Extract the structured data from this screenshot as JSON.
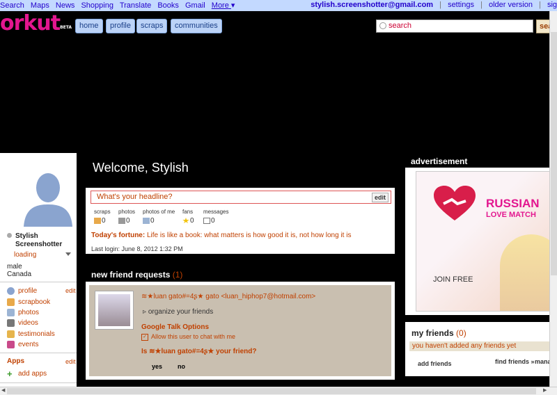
{
  "topbar": {
    "links": [
      "Search",
      "Maps",
      "News",
      "Shopping",
      "Translate",
      "Books",
      "Gmail"
    ],
    "more_label": "More",
    "more_caret": "▾",
    "email": "stylish.screenshotter@gmail.com",
    "settings": "settings",
    "older_version": "older version",
    "signout": "sig"
  },
  "logo": {
    "text": "orkut",
    "badge": "BETA"
  },
  "nav": {
    "home": "home",
    "profile": "profile",
    "scraps": "scraps",
    "communities": "communities"
  },
  "search": {
    "placeholder": "search",
    "button": "sea"
  },
  "user": {
    "name": "Stylish Screenshotter",
    "status": "loading",
    "gender": "male",
    "country": "Canada"
  },
  "leftmenu": {
    "items": [
      {
        "label": "profile",
        "icon": "person-icon"
      },
      {
        "label": "scrapbook",
        "icon": "scrapbook-icon"
      },
      {
        "label": "photos",
        "icon": "photos-icon"
      },
      {
        "label": "videos",
        "icon": "videos-icon"
      },
      {
        "label": "testimonials",
        "icon": "testimonials-icon"
      },
      {
        "label": "events",
        "icon": "events-icon"
      }
    ],
    "edit_label": "edit",
    "apps_title": "Apps",
    "apps_edit": "edit",
    "add_apps": "add apps"
  },
  "main": {
    "welcome": "Welcome, Stylish",
    "headline_placeholder": "What's your headline?",
    "edit_label": "edit",
    "stats": [
      {
        "label": "scraps",
        "count": "0"
      },
      {
        "label": "photos",
        "count": "0"
      },
      {
        "label": "photos of me",
        "count": "0"
      },
      {
        "label": "fans",
        "count": "0"
      },
      {
        "label": "messages",
        "count": "0"
      }
    ],
    "fortune_label": "Today's fortune:",
    "fortune_text": "Life is like a book: what matters is how good it is, not how long it is",
    "last_login": "Last login: June 8, 2012 1:32 PM"
  },
  "friend_requests": {
    "title": "new friend requests",
    "count": "(1)",
    "name": "≋★luan gato#=4ʂ★ gato",
    "email": "<luan_hiphop7@hotmail.com>",
    "organize": "organize your friends",
    "gtalk_title": "Google Talk Options",
    "allow_chat": "Allow this user to chat with me",
    "question": "Is ≋★luan gato#=4ʂ★ your friend?",
    "yes": "yes",
    "no": "no"
  },
  "advertisement": {
    "title": "advertisement",
    "brand_line1": "RUSSIAN",
    "brand_line2": "LOVE MATCH",
    "cta": "JOIN FREE"
  },
  "my_friends": {
    "title": "my friends",
    "count": "(0)",
    "empty": "you haven't added any friends yet",
    "add": "add friends",
    "find": "find friends »",
    "manage": "mana"
  }
}
